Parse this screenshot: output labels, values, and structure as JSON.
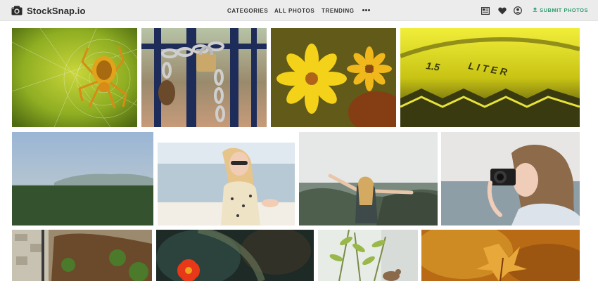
{
  "brand": {
    "name": "StockSnap.io",
    "icon": "camera-icon"
  },
  "nav": {
    "categories": "CATEGORIES",
    "all_photos": "ALL PHOTOS",
    "trending": "TRENDING",
    "more_icon": "more-dots-icon"
  },
  "toolbar": {
    "id_card_icon": "id-card-icon",
    "favorites_icon": "heart-icon",
    "account_icon": "user-icon",
    "submit_icon": "upload-icon",
    "submit_label": "SUBMIT PHOTOS"
  },
  "colors": {
    "topbar_bg": "#ececec",
    "accent": "#2e9c6e"
  },
  "photos": [
    {
      "subject": "spider-on-web"
    },
    {
      "subject": "padlock-chain-gate"
    },
    {
      "subject": "yellow-flowers"
    },
    {
      "subject": "bottle-label-macro"
    },
    {
      "subject": "foggy-field"
    },
    {
      "subject": "woman-on-beach"
    },
    {
      "subject": "woman-on-cliff"
    },
    {
      "subject": "woman-with-camera"
    },
    {
      "subject": "stone-wall-plants"
    },
    {
      "subject": "red-flower-blur"
    },
    {
      "subject": "bird-among-plants"
    },
    {
      "subject": "autumn-leaves"
    }
  ]
}
